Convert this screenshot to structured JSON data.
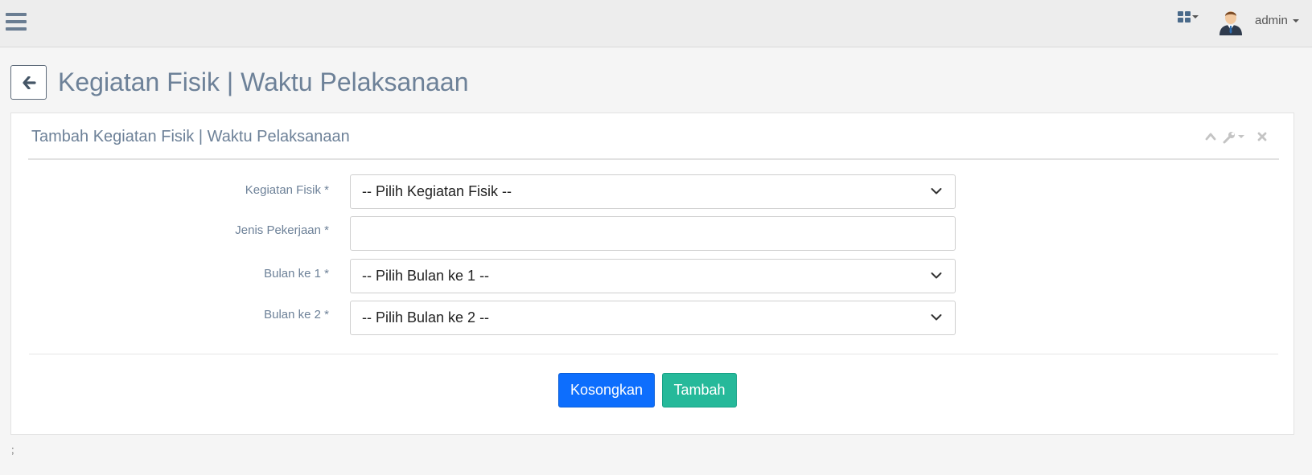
{
  "navbar": {
    "menu_icon": "hamburger-icon",
    "apps_icon": "grid-icon",
    "user": {
      "name": "admin",
      "avatar_icon": "user-avatar"
    }
  },
  "page": {
    "back_icon": "arrow-left-icon",
    "title": "Kegiatan Fisik | Waktu Pelaksanaan"
  },
  "panel": {
    "title": "Tambah Kegiatan Fisik | Waktu Pelaksanaan",
    "tools": [
      "chevron-up-icon",
      "wrench-icon",
      "close-icon"
    ]
  },
  "form": {
    "kegiatan_fisik": {
      "label": "Kegiatan Fisik *",
      "value": "-- Pilih Kegiatan Fisik --"
    },
    "jenis_pekerjaan": {
      "label": "Jenis Pekerjaan *",
      "value": "",
      "placeholder": ""
    },
    "bulan_1": {
      "label": "Bulan ke 1 *",
      "value": "-- Pilih Bulan ke 1 --"
    },
    "bulan_2": {
      "label": "Bulan ke 2 *",
      "value": "-- Pilih Bulan ke 2 --"
    }
  },
  "buttons": {
    "reset": "Kosongkan",
    "add": "Tambah"
  },
  "footer": {
    "text": ";"
  },
  "colors": {
    "reset_button": "#0d6efd",
    "add_button": "#26b99a",
    "title_text": "#6d8198",
    "navbar_bg": "#ededed"
  }
}
